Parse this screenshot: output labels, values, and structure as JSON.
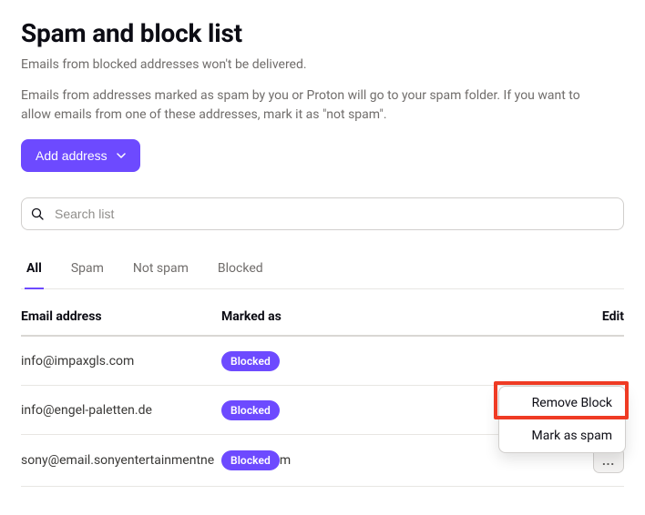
{
  "header": {
    "title": "Spam and block list",
    "desc1": "Emails from blocked addresses won't be delivered.",
    "desc2": "Emails from addresses marked as spam by you or Proton will go to your spam folder. If you want to allow emails from one of these addresses, mark it as \"not spam\"."
  },
  "add_button": {
    "label": "Add address"
  },
  "search": {
    "placeholder": "Search list"
  },
  "tabs": [
    {
      "label": "All",
      "active": true
    },
    {
      "label": "Spam",
      "active": false
    },
    {
      "label": "Not spam",
      "active": false
    },
    {
      "label": "Blocked",
      "active": false
    }
  ],
  "table": {
    "columns": {
      "email": "Email address",
      "marked": "Marked as",
      "edit": "Edit"
    },
    "rows": [
      {
        "email": "info@impaxgls.com",
        "marked": "Blocked",
        "trail": ""
      },
      {
        "email": "info@engel-paletten.de",
        "marked": "Blocked",
        "trail": ""
      },
      {
        "email": "sony@email.sonyentertainmentne",
        "marked": "Blocked",
        "trail": "m"
      }
    ]
  },
  "dropdown": {
    "items": [
      "Remove Block",
      "Mark as spam"
    ]
  },
  "more_glyph": "..."
}
